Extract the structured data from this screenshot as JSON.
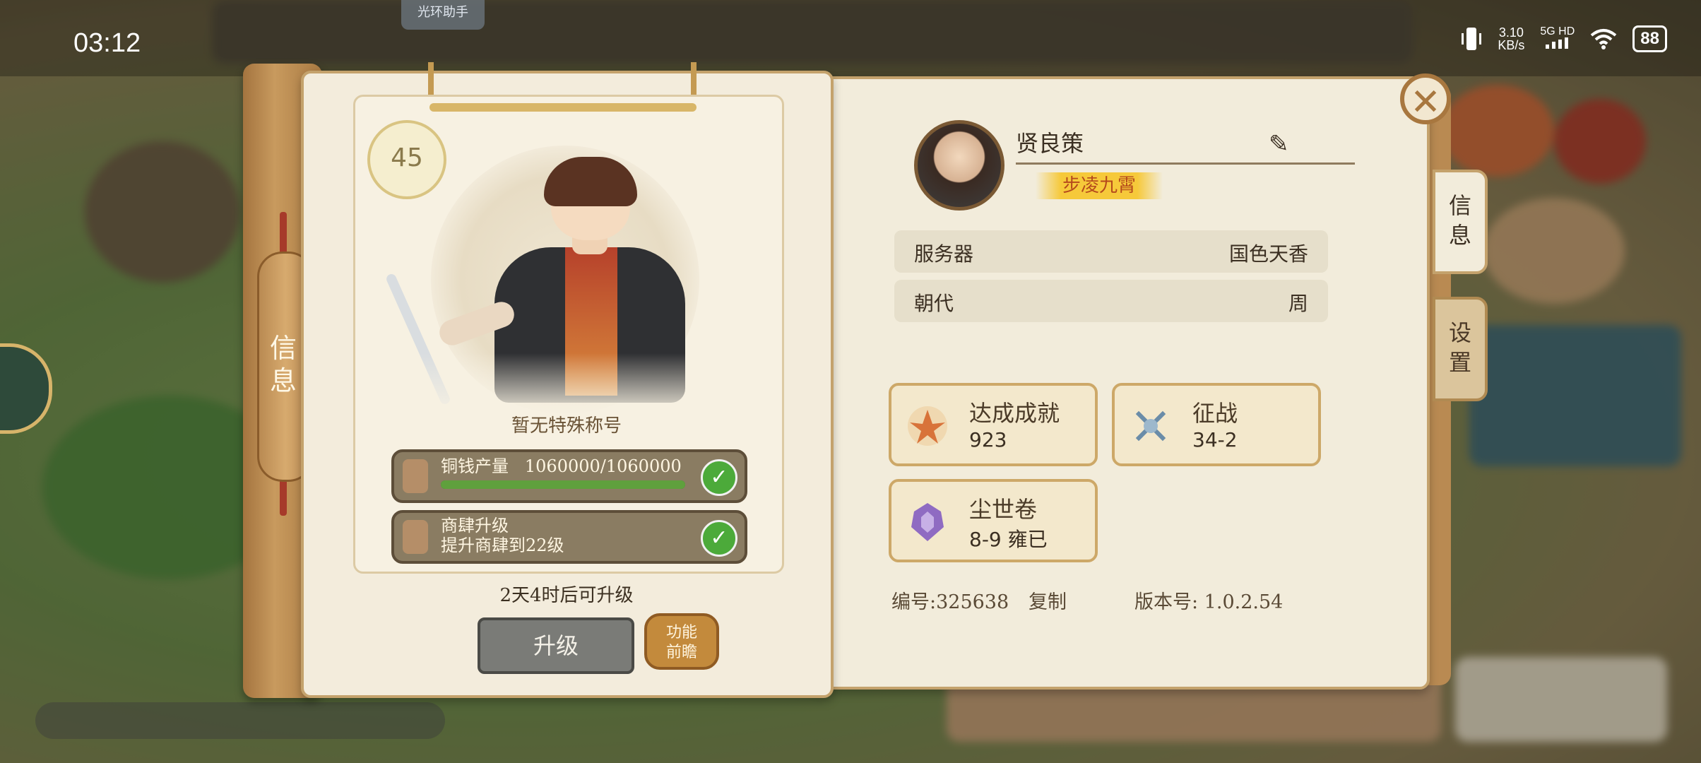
{
  "status_bar": {
    "time": "03:12",
    "assistant_label": "光环助手",
    "net_speed": "3.10",
    "net_speed_unit": "KB/s",
    "signal_label": "5G HD",
    "battery": "88"
  },
  "book": {
    "spine_label": "信息"
  },
  "character": {
    "level": "45",
    "special_title": "暂无特殊称号",
    "tasks": [
      {
        "label": "铜钱产量",
        "value": "1060000/1060000",
        "progress": 1.0,
        "done": true
      },
      {
        "label": "商肆升级",
        "detail": "提升商肆到22级",
        "done": true
      }
    ],
    "countdown": "2天4时后可升级",
    "upgrade_label": "升级",
    "preview_label_1": "功能",
    "preview_label_2": "前瞻"
  },
  "profile": {
    "name": "贤良策",
    "title_ribbon": "步凌九霄",
    "rows": [
      {
        "key": "服务器",
        "value": "国色天香"
      },
      {
        "key": "朝代",
        "value": "周"
      }
    ],
    "stats": [
      {
        "title": "达成成就",
        "value": "923",
        "icon": "phoenix-icon"
      },
      {
        "title": "征战",
        "value": "34-2",
        "icon": "crossed-swords-icon"
      },
      {
        "title": "尘世卷",
        "value": "8-9 雍已",
        "icon": "purple-emblem-icon"
      }
    ],
    "id_label": "编号:325638",
    "copy_label": "复制",
    "version_label": "版本号:  1.0.2.54"
  },
  "tabs": [
    {
      "label": "信息",
      "active": true
    },
    {
      "label": "设置",
      "active": false
    }
  ],
  "colors": {
    "page": "#f2ecdb",
    "wood": "#b98a52",
    "check_green": "#4caa3a",
    "ribbon_gold": "#f6c93a"
  }
}
